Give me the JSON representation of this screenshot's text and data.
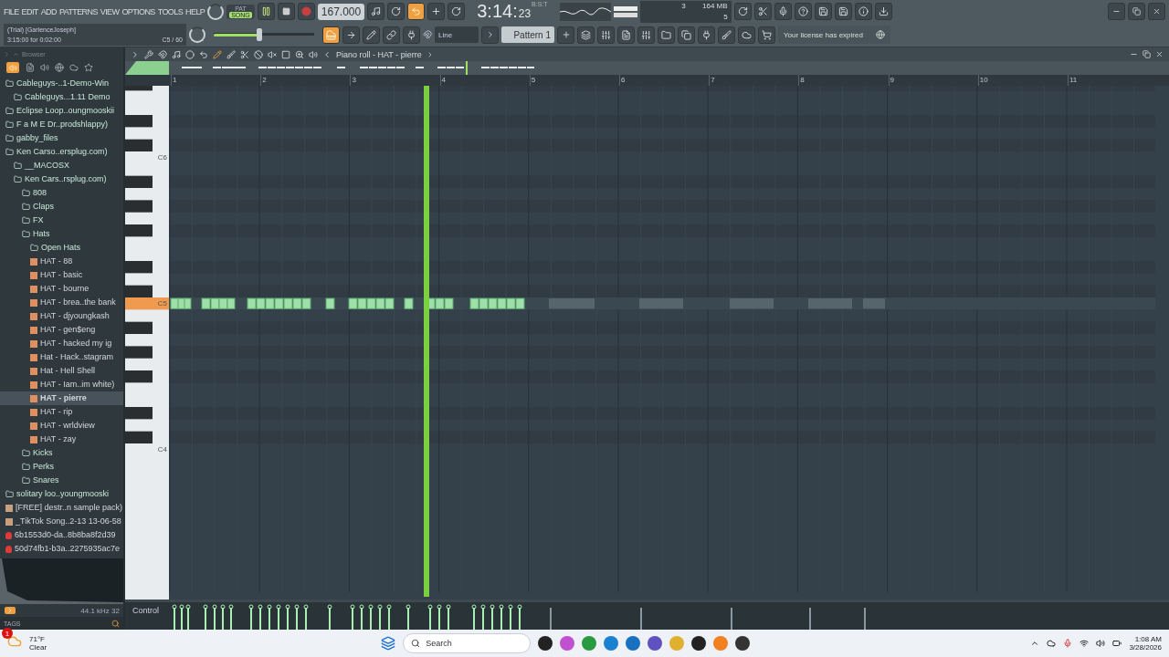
{
  "menu": [
    "FILE",
    "EDIT",
    "ADD",
    "PATTERNS",
    "VIEW",
    "OPTIONS",
    "TOOLS",
    "HELP"
  ],
  "trial": {
    "user": "(Trial) [GarlenceJoseph]",
    "time": "3:15:00 for 0:02:00",
    "note": "C5 / 60"
  },
  "transport": {
    "mode_top": "PAT",
    "mode": "SONG",
    "song_mode": true,
    "playing": true,
    "recording": false,
    "tempo": "167.000"
  },
  "master_volume": {
    "level": 0.45
  },
  "clock": {
    "time": "3:14:",
    "sub": "23",
    "unit": "B:S:T"
  },
  "monitor": {
    "cpu": "3",
    "memory": "164 MB",
    "polyphony": "5"
  },
  "snap": {
    "value": "Line"
  },
  "pattern": {
    "name": "Pattern 1"
  },
  "license": "Your license has expired",
  "browser": {
    "title": "Browser",
    "items": [
      {
        "label": "Cableguys-..1-Demo-Win",
        "kind": "folder",
        "selected": false,
        "children": [
          {
            "label": "Cableguys...1.11 Demo",
            "kind": "folder",
            "selected": false
          }
        ]
      },
      {
        "label": "Eclipse Loop..oungmooskii",
        "kind": "folder",
        "selected": false
      },
      {
        "label": "F a M E  Dr..prodshlappy)",
        "kind": "folder",
        "selected": false
      },
      {
        "label": "gabby_files",
        "kind": "folder",
        "selected": false
      },
      {
        "label": "Ken Carso..ersplug.com)",
        "kind": "folder",
        "selected": false,
        "children": [
          {
            "label": "__MACOSX",
            "kind": "folder",
            "selected": false
          },
          {
            "label": "Ken Cars..rsplug.com)",
            "kind": "folder",
            "selected": false,
            "children": [
              {
                "label": "808",
                "kind": "folder",
                "selected": false
              },
              {
                "label": "Claps",
                "kind": "folder",
                "selected": false
              },
              {
                "label": "FX",
                "kind": "folder",
                "selected": false
              },
              {
                "label": "Hats",
                "kind": "folder",
                "selected": false,
                "children": [
                  {
                    "label": "Open Hats",
                    "kind": "folder",
                    "selected": false
                  },
                  {
                    "label": "HAT - 88",
                    "kind": "midi",
                    "selected": false
                  },
                  {
                    "label": "HAT - basic",
                    "kind": "midi",
                    "selected": false
                  },
                  {
                    "label": "HAT - bourne",
                    "kind": "midi",
                    "selected": false
                  },
                  {
                    "label": "HAT - brea..the bank",
                    "kind": "midi",
                    "selected": false
                  },
                  {
                    "label": "HAT - djyoungkash",
                    "kind": "midi",
                    "selected": false
                  },
                  {
                    "label": "HAT - gen$eng",
                    "kind": "midi",
                    "selected": false
                  },
                  {
                    "label": "HAT - hacked my ig",
                    "kind": "midi",
                    "selected": false
                  },
                  {
                    "label": "Hat - Hack..stagram",
                    "kind": "midi",
                    "selected": false
                  },
                  {
                    "label": "Hat - Hell Shell",
                    "kind": "midi",
                    "selected": false
                  },
                  {
                    "label": "HAT - Iam..im white)",
                    "kind": "midi",
                    "selected": false
                  },
                  {
                    "label": "HAT - pierre",
                    "kind": "midi",
                    "selected": true
                  },
                  {
                    "label": "HAT - rip",
                    "kind": "midi",
                    "selected": false
                  },
                  {
                    "label": "HAT - wrldview",
                    "kind": "midi",
                    "selected": false
                  },
                  {
                    "label": "HAT - zay",
                    "kind": "midi",
                    "selected": false
                  }
                ]
              },
              {
                "label": "Kicks",
                "kind": "folder",
                "selected": false
              },
              {
                "label": "Perks",
                "kind": "folder",
                "selected": false
              },
              {
                "label": "Snares",
                "kind": "folder",
                "selected": false
              }
            ]
          }
        ]
      },
      {
        "label": "solitary loo..youngmooski",
        "kind": "folder",
        "selected": false
      },
      {
        "label": "[FREE] destr..n sample pack)",
        "kind": "archive",
        "selected": false
      },
      {
        "label": "_TikTok Song..2-13 13-06-58",
        "kind": "archive",
        "selected": false
      },
      {
        "label": "6b1553d0-da..8b8ba8f2d39",
        "kind": "audio",
        "selected": false
      },
      {
        "label": "50d74fb1-b3a..2275935ac7e",
        "kind": "audio",
        "selected": false
      }
    ],
    "sample_info": "44.1 kHz 32",
    "tags": "TAGS"
  },
  "piano_roll": {
    "title": "Piano roll - HAT - pierre",
    "bars": [
      "1",
      "2",
      "3",
      "4",
      "5",
      "6",
      "7",
      "8",
      "9",
      "10",
      "11"
    ],
    "key_labels": [
      "C6",
      "C5",
      "C4"
    ],
    "control": "Control"
  },
  "taskbar": {
    "temperature": "71°F",
    "weather": "Clear",
    "alerts": "1",
    "search": "Search",
    "time": "1:08 AM",
    "date": "3/28/2026"
  }
}
